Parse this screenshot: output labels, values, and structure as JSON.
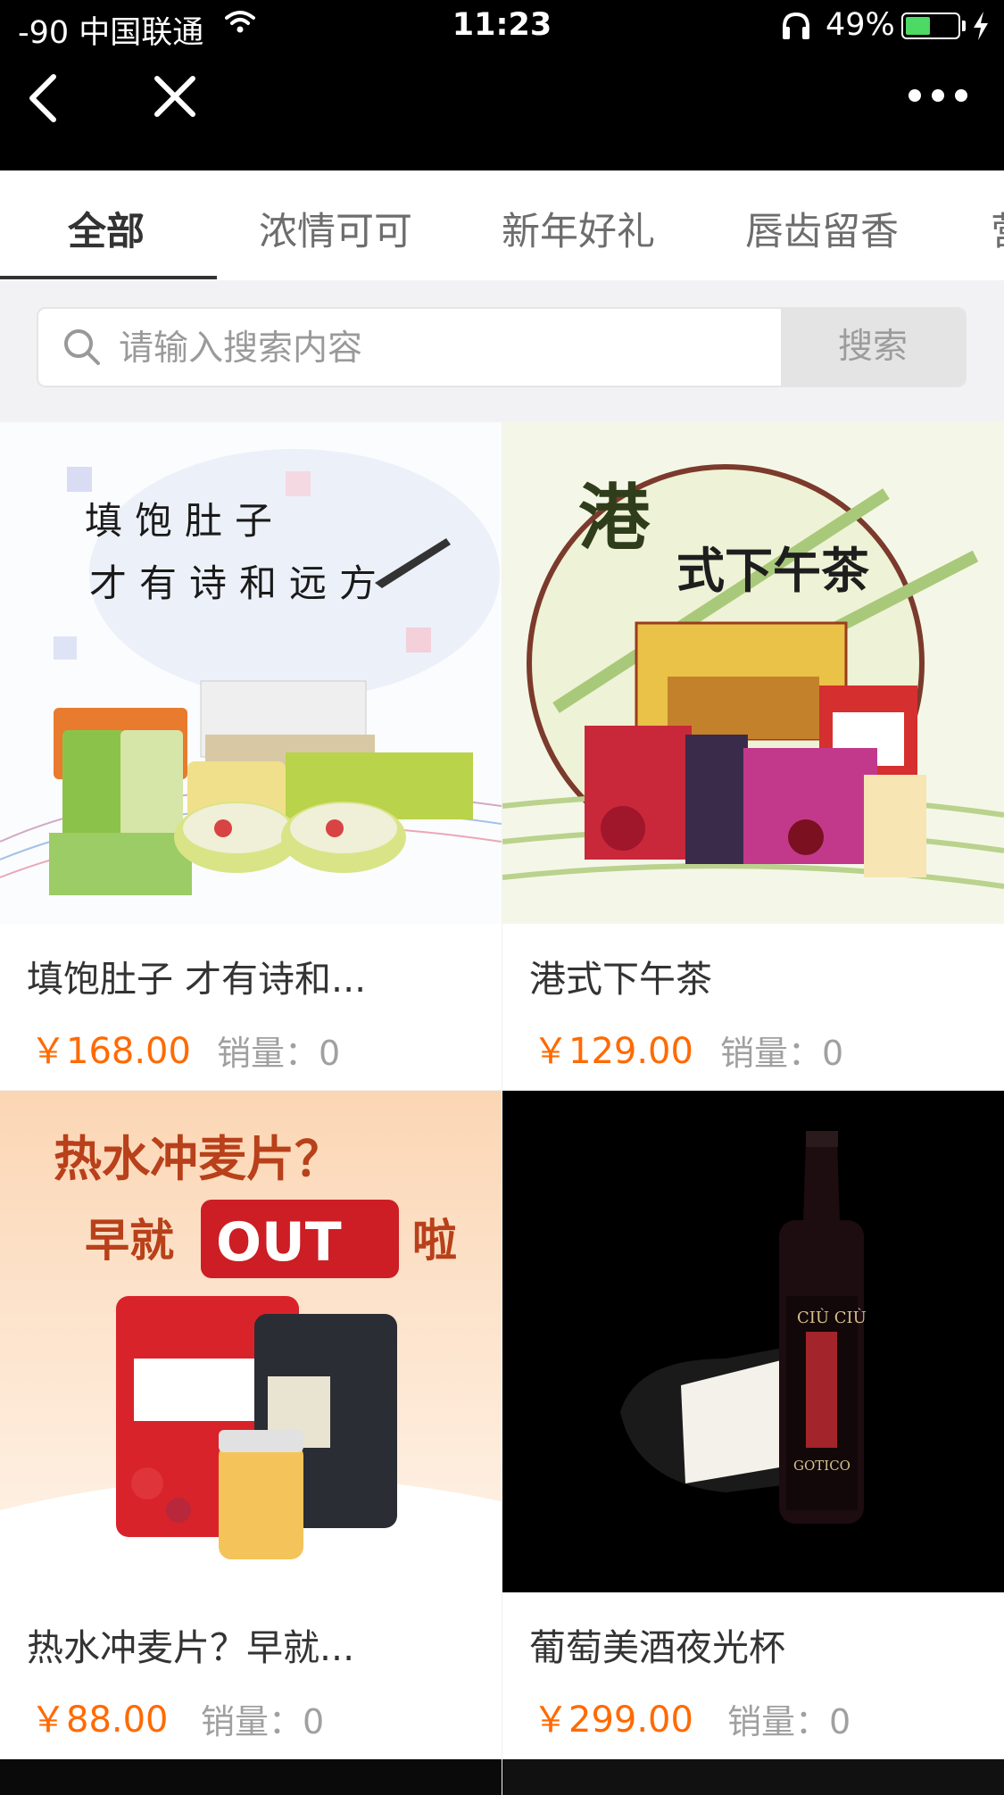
{
  "status_bar": {
    "carrier": "-90 中国联通",
    "time": "11:23",
    "battery_percent_text": "49%",
    "battery_level": 0.49
  },
  "nav": {
    "back_icon": "chevron-left-icon",
    "close_icon": "close-icon",
    "more_icon": "more-horizontal-icon"
  },
  "tabs": [
    {
      "label": "全部",
      "active": true
    },
    {
      "label": "浓情可可"
    },
    {
      "label": "新年好礼"
    },
    {
      "label": "唇齿留香"
    },
    {
      "label": "营"
    }
  ],
  "search": {
    "placeholder": "请输入搜索内容",
    "button_label": "搜索"
  },
  "products": [
    {
      "title": "填饱肚子 才有诗和...",
      "price": "￥168.00",
      "sales_label": "销量：",
      "sales_value": "0",
      "image_text": [
        "填饱肚子",
        "才有诗和远方"
      ]
    },
    {
      "title": "港式下午茶",
      "price": "￥129.00",
      "sales_label": "销量：",
      "sales_value": "0",
      "image_text": [
        "港",
        "式下午茶"
      ]
    },
    {
      "title": "热水冲麦片？早就...",
      "price": "￥88.00",
      "sales_label": "销量：",
      "sales_value": "0",
      "image_text": [
        "热水冲麦片？",
        "早就",
        "OUT",
        "啦"
      ]
    },
    {
      "title": "葡萄美酒夜光杯",
      "price": "￥299.00",
      "sales_label": "销量：",
      "sales_value": "0",
      "image_text": [
        "CIÙ CIÙ",
        "GOTICO"
      ]
    }
  ],
  "colors": {
    "price": "#ff6a00",
    "topbar": "#000000",
    "page_bg": "#f2f2f4"
  }
}
